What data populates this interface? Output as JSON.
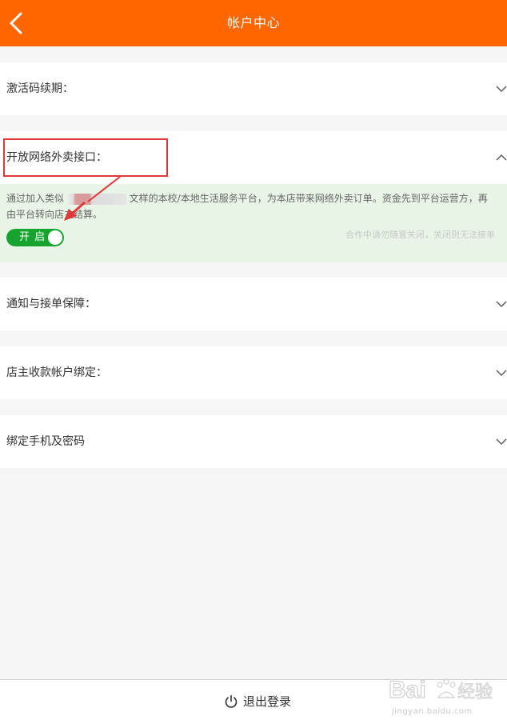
{
  "header": {
    "title": "帐户中心",
    "back_icon": "chevron-left-icon"
  },
  "sections": {
    "activation": {
      "label": "激活码续期："
    },
    "takeout": {
      "label": "开放网络外卖接口：",
      "desc_part1": "通过加入类似",
      "desc_part2": "文样的本校/本地生活服务平台，为本店带来网络外卖订单。资金先到平台运营方，再由平台转向店主结算。",
      "toggle_label": "开 启",
      "hint": "合作中请勿随意关闭，关闭则无法接单"
    },
    "notify": {
      "label": "通知与接单保障："
    },
    "account": {
      "label": "店主收款帐户绑定："
    },
    "phone": {
      "label": "绑定手机及密码"
    }
  },
  "footer": {
    "logout_label": "退出登录",
    "logout_icon": "power-icon"
  },
  "watermark": {
    "text": "Bai经验",
    "sub": "jingyan.baidu.com"
  },
  "colors": {
    "header": "#ff6600",
    "toggle": "#16a32e",
    "panel": "#e8f5e6",
    "annotation": "#e0383a"
  }
}
